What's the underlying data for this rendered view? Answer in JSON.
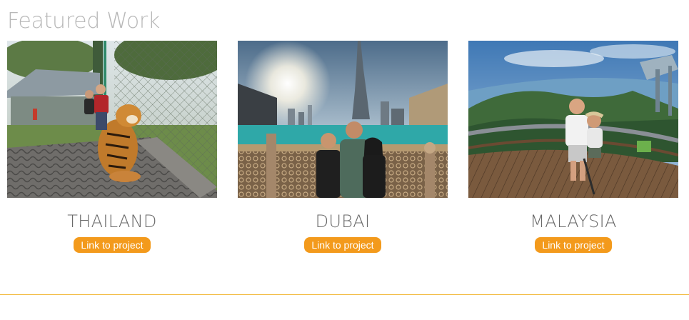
{
  "section": {
    "title": "Featured Work"
  },
  "projects": [
    {
      "title": "THAILAND",
      "link_label": "Link to project"
    },
    {
      "title": "DUBAI",
      "link_label": "Link to project"
    },
    {
      "title": "MALAYSIA",
      "link_label": "Link to project"
    }
  ],
  "colors": {
    "button_bg": "#f39a1c",
    "divider": "#f2b93b",
    "title_text": "#b8b8b8"
  }
}
